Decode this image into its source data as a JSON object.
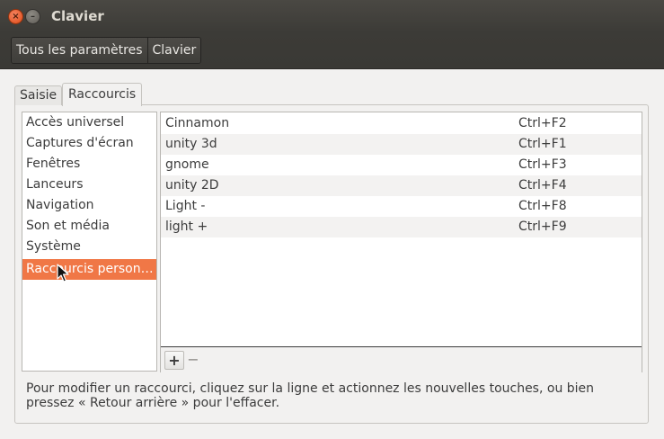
{
  "window": {
    "title": "Clavier",
    "close_symbol": "×",
    "minimize_symbol": "–"
  },
  "breadcrumb": {
    "items": [
      "Tous les paramètres",
      "Clavier"
    ]
  },
  "tabs": [
    {
      "label": "Saisie",
      "active": false
    },
    {
      "label": "Raccourcis",
      "active": true
    }
  ],
  "categories": {
    "items": [
      "Accès universel",
      "Captures d'écran",
      "Fenêtres",
      "Lanceurs",
      "Navigation",
      "Son et média",
      "Système",
      "Raccourcis person…"
    ],
    "selected_index": 7
  },
  "shortcuts": {
    "rows": [
      {
        "name": "Cinnamon",
        "key": "Ctrl+F2"
      },
      {
        "name": "unity 3d",
        "key": "Ctrl+F1"
      },
      {
        "name": "gnome",
        "key": "Ctrl+F3"
      },
      {
        "name": "unity 2D",
        "key": "Ctrl+F4"
      },
      {
        "name": "Light -",
        "key": "Ctrl+F8"
      },
      {
        "name": "light +",
        "key": "Ctrl+F9"
      }
    ],
    "add_symbol": "+",
    "remove_symbol": "−"
  },
  "help_text": "Pour modifier un raccourci, cliquez sur la ligne et actionnez les nouvelles touches, ou bien pressez « Retour arrière » pour l'effacer.",
  "colors": {
    "selection": "#f07746",
    "titlebar": "#3c3b37"
  }
}
